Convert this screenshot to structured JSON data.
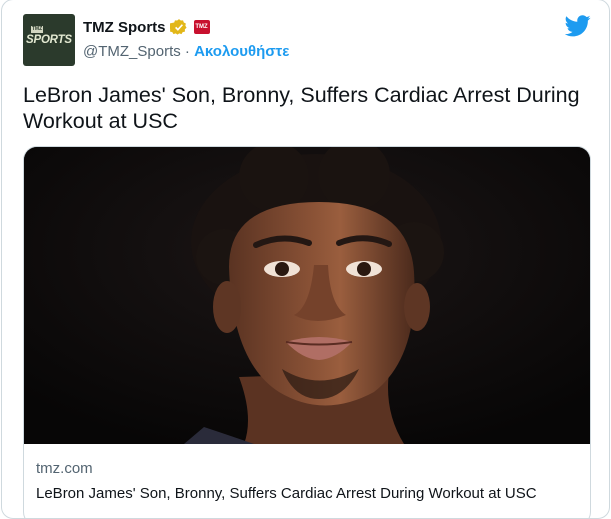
{
  "author": {
    "name": "TMZ Sports",
    "handle": "@TMZ_Sports",
    "separator": " · ",
    "follow_label": "Ακολουθήστε",
    "avatar_text": "SPORTS",
    "avatar_small_text": "TMZ"
  },
  "tweet": {
    "text": "LeBron James' Son, Bronny, Suffers Cardiac Arrest During Workout at USC"
  },
  "card": {
    "domain": "tmz.com",
    "title": "LeBron James' Son, Bronny, Suffers Cardiac Arrest During Workout at USC"
  },
  "colors": {
    "accent": "#1d9bf0",
    "verified_gold": "#e2b719",
    "badge_red": "#c8102e"
  },
  "icons": {
    "verified": "verified-badge-icon",
    "affiliate": "tmz-affiliate-icon",
    "brand": "twitter-bird-icon"
  }
}
